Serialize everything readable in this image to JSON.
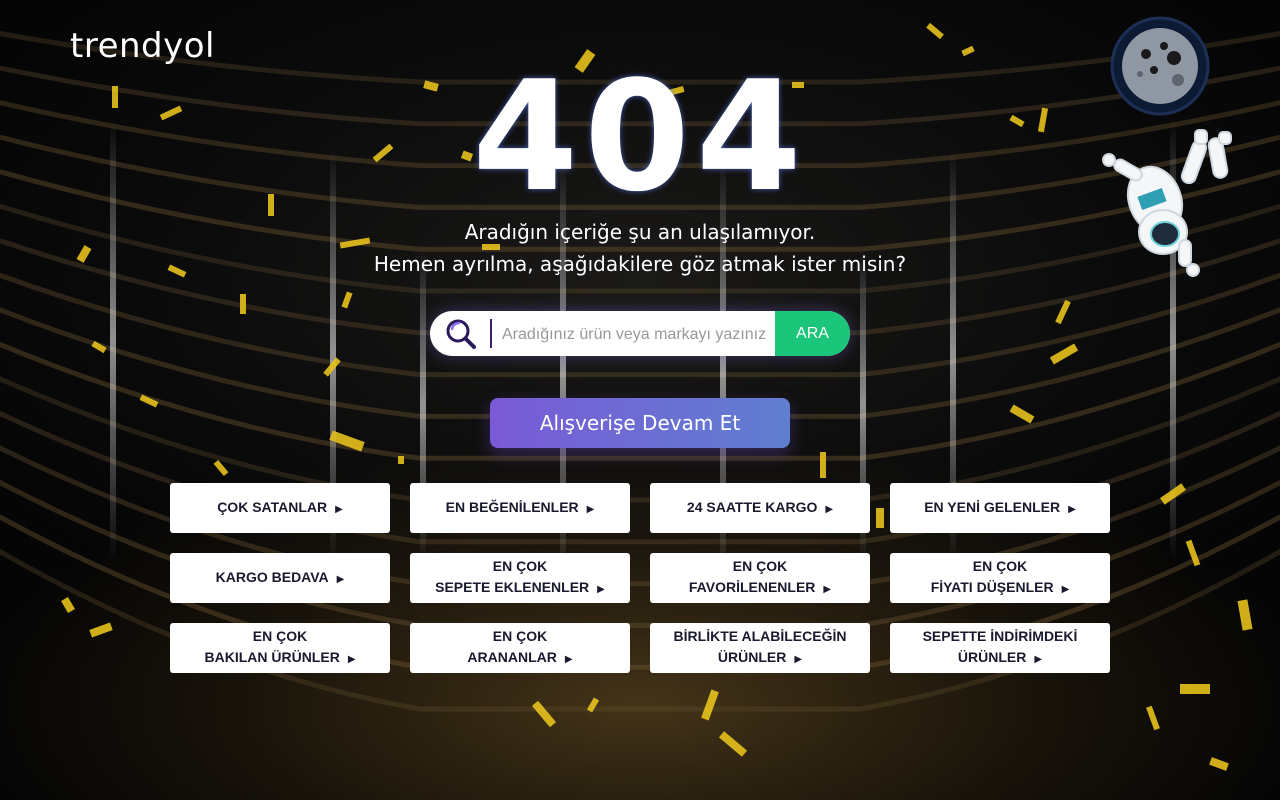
{
  "brand": {
    "logo_text": "trendyol"
  },
  "error": {
    "code": "404",
    "line1": "Aradığın içeriğe şu an ulaşılamıyor.",
    "line2": "Hemen ayrılma, aşağıdakilere göz atmak ister misin?"
  },
  "search": {
    "placeholder": "Aradığınız ürün veya markayı yazınız",
    "button_label": "ARA"
  },
  "continue_button": "Alışverişe Devam Et",
  "links": [
    {
      "line1": "ÇOK SATANLAR",
      "line2": ""
    },
    {
      "line1": "EN BEĞENİLENLER",
      "line2": ""
    },
    {
      "line1": "24 SAATTE KARGO",
      "line2": ""
    },
    {
      "line1": "EN YENİ GELENLER",
      "line2": ""
    },
    {
      "line1": "KARGO BEDAVA",
      "line2": ""
    },
    {
      "line1": "EN ÇOK",
      "line2": "SEPETE EKLENENLER"
    },
    {
      "line1": "EN ÇOK",
      "line2": "FAVORİLENENLER"
    },
    {
      "line1": "EN ÇOK",
      "line2": "FİYATI DÜŞENLER"
    },
    {
      "line1": "EN ÇOK",
      "line2": "BAKILAN ÜRÜNLER"
    },
    {
      "line1": "EN ÇOK",
      "line2": "ARANANLAR"
    },
    {
      "line1": "BİRLİKTE ALABİLECEĞİN",
      "line2": "ÜRÜNLER"
    },
    {
      "line1": "SEPETTE İNDİRİMDEKİ",
      "line2": "ÜRÜNLER"
    }
  ],
  "icons": {
    "arrow": "▶",
    "search": "search-icon",
    "moon": "moon-icon",
    "astronaut": "astronaut-icon"
  },
  "colors": {
    "search_button": "#1bc57a",
    "continue_start": "#7a5ad6",
    "continue_end": "#5f7fd0",
    "confetti": "#e8c21c"
  }
}
